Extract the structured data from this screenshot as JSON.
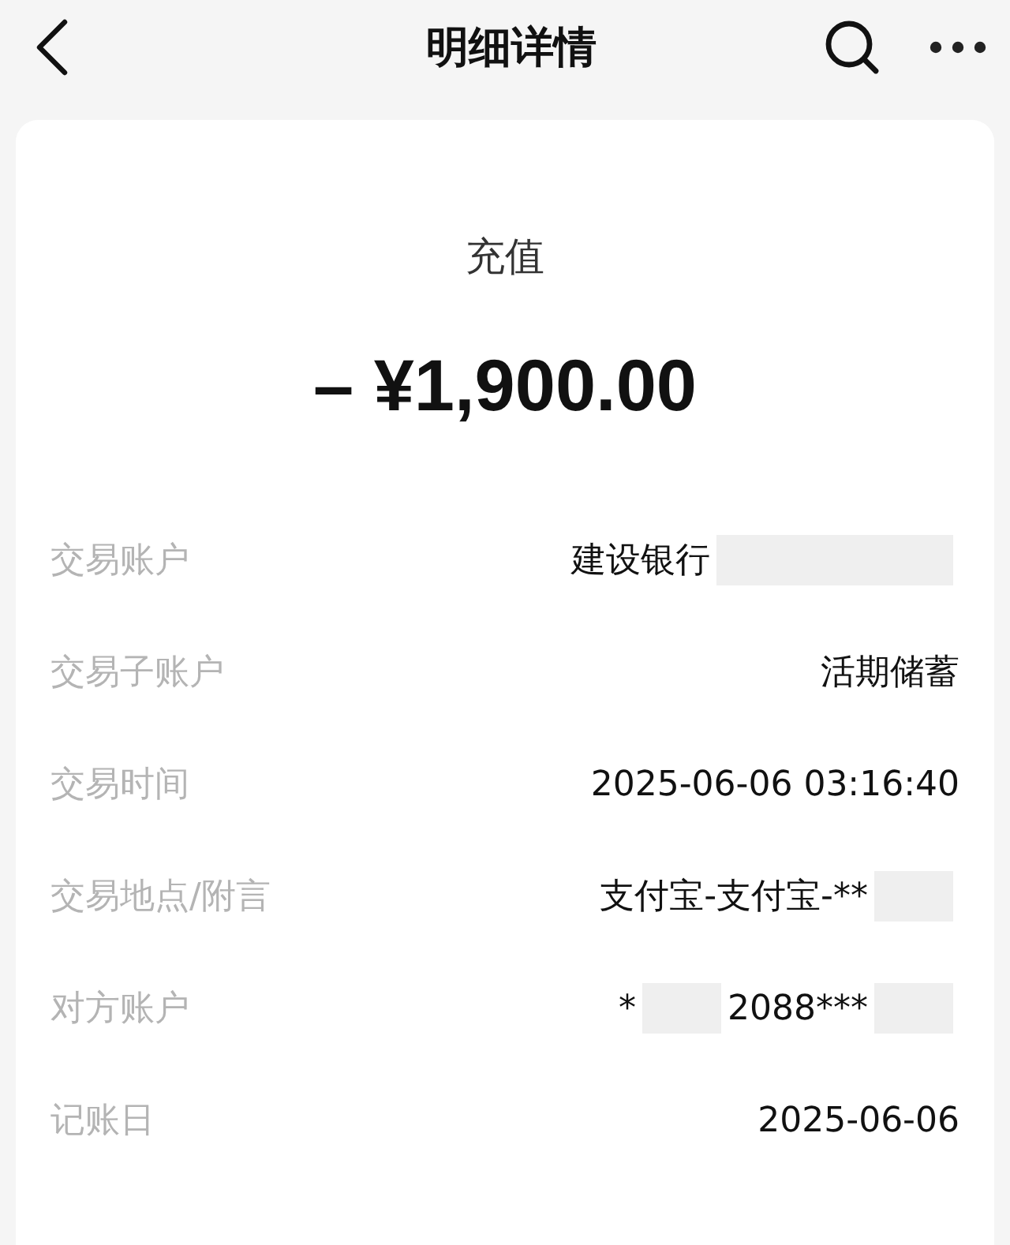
{
  "header": {
    "title": "明细详情"
  },
  "transaction": {
    "type": "充值",
    "amount": "– ¥1,900.00"
  },
  "rows": [
    {
      "label": "交易账户",
      "value": [
        {
          "kind": "text",
          "text": "建设银行"
        },
        {
          "kind": "redacted"
        }
      ]
    },
    {
      "label": "交易子账户",
      "value": [
        {
          "kind": "text",
          "text": "活期储蓄"
        }
      ]
    },
    {
      "label": "交易时间",
      "value": [
        {
          "kind": "text",
          "text": "2025-06-06 03:16:40"
        }
      ]
    },
    {
      "label": "交易地点/附言",
      "value": [
        {
          "kind": "text",
          "text": "支付宝-支付宝-**"
        },
        {
          "kind": "redacted"
        }
      ]
    },
    {
      "label": "对方账户",
      "value": [
        {
          "kind": "text",
          "text": "*"
        },
        {
          "kind": "redacted"
        },
        {
          "kind": "text",
          "text": "2088***"
        },
        {
          "kind": "redacted"
        }
      ]
    },
    {
      "label": "记账日",
      "value": [
        {
          "kind": "text",
          "text": "2025-06-06"
        }
      ]
    }
  ]
}
